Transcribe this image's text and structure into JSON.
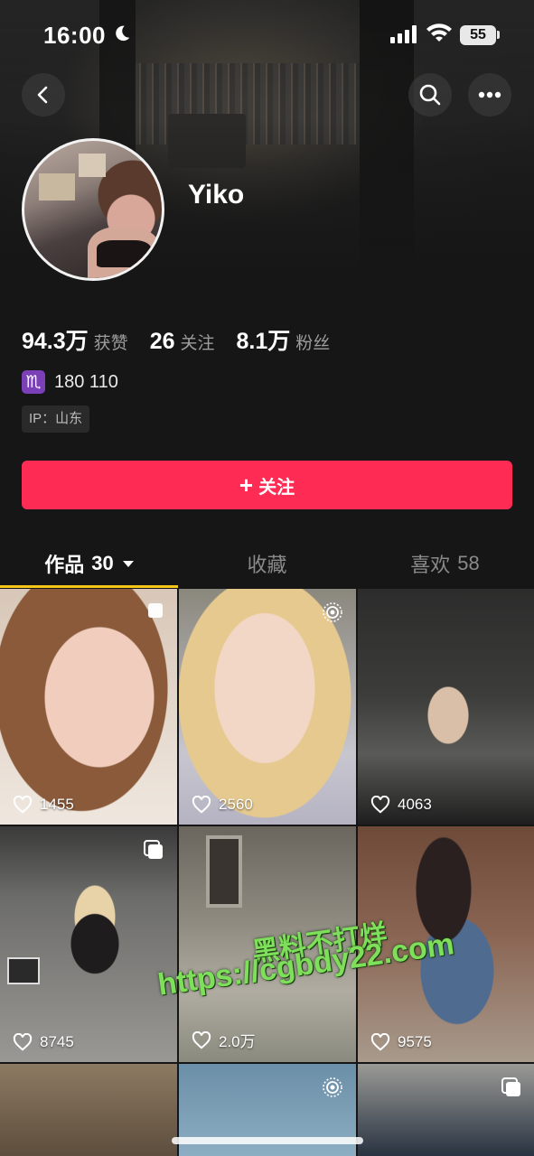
{
  "status_bar": {
    "time": "16:00",
    "battery": "55"
  },
  "profile": {
    "name": "Yiko",
    "stats": [
      {
        "value": "94.3万",
        "label": "获赞"
      },
      {
        "value": "26",
        "label": "关注"
      },
      {
        "value": "8.1万",
        "label": "粉丝"
      }
    ],
    "zodiac_symbol": "♏",
    "height_weight": "180 110",
    "ip_location": "IP：山东",
    "follow_label": "关注"
  },
  "tabs": [
    {
      "label": "作品",
      "count": "30",
      "active": true
    },
    {
      "label": "收藏",
      "count": "",
      "active": false
    },
    {
      "label": "喜欢",
      "count": "58",
      "active": false
    }
  ],
  "posts": [
    {
      "likes": "1455",
      "badge": "pin"
    },
    {
      "likes": "2560",
      "badge": "live"
    },
    {
      "likes": "4063",
      "badge": ""
    },
    {
      "likes": "8745",
      "badge": "multi"
    },
    {
      "likes": "2.0万",
      "badge": ""
    },
    {
      "likes": "9575",
      "badge": ""
    },
    {
      "likes": "",
      "badge": ""
    },
    {
      "likes": "",
      "badge": "live"
    },
    {
      "likes": "",
      "badge": "multi"
    }
  ],
  "watermark": {
    "line1": "黑料不打烊",
    "line2": "https://cgbdy22.com"
  },
  "colors": {
    "accent": "#fe2c55",
    "tab_underline": "#f5c518",
    "background": "#161616"
  }
}
